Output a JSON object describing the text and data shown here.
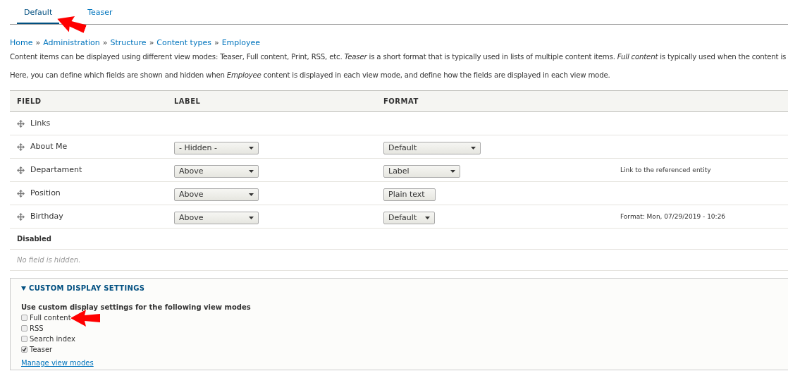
{
  "tabs": [
    {
      "label": "Default",
      "selected": true
    },
    {
      "label": "Teaser",
      "selected": false
    }
  ],
  "breadcrumb": [
    "Home",
    "Administration",
    "Structure",
    "Content types",
    "Employee"
  ],
  "breadcrumb_separator": "»",
  "paragraphs": [
    "Content items can be displayed using different view modes: Teaser, Full content, Print, RSS, etc. *Teaser* is a short format that is typically used in lists of multiple content items. *Full content* is typically used when the content is",
    "Here, you can define which fields are shown and hidden when *Employee* content is displayed in each view mode, and define how the fields are displayed in each view mode."
  ],
  "table": {
    "columns": [
      "FIELD",
      "LABEL",
      "FORMAT"
    ],
    "rows": [
      {
        "field": "Links"
      },
      {
        "field": "About Me",
        "label": "- Hidden -",
        "format": "Default"
      },
      {
        "field": "Departament",
        "label": "Above",
        "format": "Label",
        "summary": "Link to the referenced entity"
      },
      {
        "field": "Position",
        "label": "Above",
        "format": "Plain text"
      },
      {
        "field": "Birthday",
        "label": "Above",
        "format": "Default",
        "summary": "Format: Mon, 07/29/2019 - 10:26"
      }
    ],
    "disabled_heading": "Disabled",
    "empty_message": "No field is hidden."
  },
  "custom_settings": {
    "title": "CUSTOM DISPLAY SETTINGS",
    "expanded": true,
    "legend": "Use custom display settings for the following view modes",
    "options": [
      {
        "label": "Full content",
        "checked": false
      },
      {
        "label": "RSS",
        "checked": false
      },
      {
        "label": "Search index",
        "checked": false
      },
      {
        "label": "Teaser",
        "checked": true
      }
    ],
    "link": "Manage view modes"
  }
}
